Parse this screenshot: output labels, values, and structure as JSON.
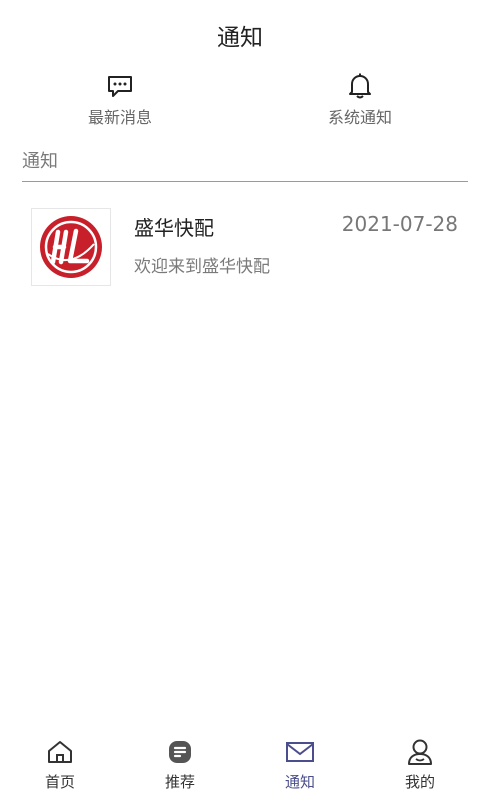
{
  "header": {
    "title": "通知"
  },
  "quick": [
    {
      "label": "最新消息",
      "icon": "chat-dots-icon"
    },
    {
      "label": "系统通知",
      "icon": "bell-icon"
    }
  ],
  "search": {
    "placeholder": "通知",
    "value": ""
  },
  "notifications": [
    {
      "title": "盛华快配",
      "date": "2021-07-28",
      "message": "欢迎来到盛华快配",
      "logo": "shenghua-logo"
    }
  ],
  "tabs": [
    {
      "label": "首页",
      "icon": "home-icon"
    },
    {
      "label": "推荐",
      "icon": "recommend-icon"
    },
    {
      "label": "通知",
      "icon": "mail-icon",
      "active": true
    },
    {
      "label": "我的",
      "icon": "user-icon"
    }
  ],
  "colors": {
    "active": "#4b4e8c",
    "logo_red": "#c8202a"
  }
}
